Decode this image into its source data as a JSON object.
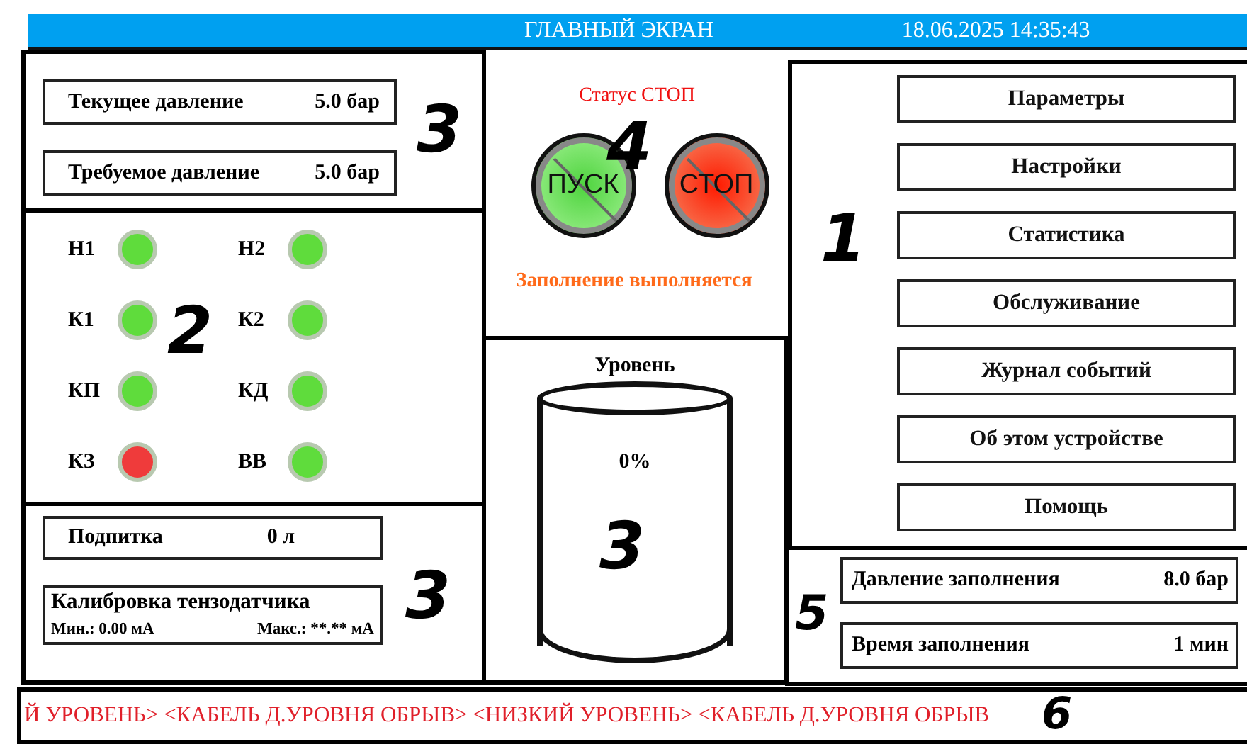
{
  "header": {
    "title": "ГЛАВНЫЙ ЭКРАН",
    "datetime": "18.06.2025 14:35:43"
  },
  "pressure_panel": {
    "callout": "3",
    "fields": [
      {
        "label": "Текущее давление",
        "value": "5.0 бар"
      },
      {
        "label": "Требуемое давление",
        "value": "5.0 бар"
      }
    ]
  },
  "lamps_panel": {
    "callout": "2",
    "lamps": [
      {
        "label": "Н1",
        "color": "#5fdc3c"
      },
      {
        "label": "Н2",
        "color": "#5fdc3c"
      },
      {
        "label": "К1",
        "color": "#5fdc3c"
      },
      {
        "label": "К2",
        "color": "#5fdc3c"
      },
      {
        "label": "КП",
        "color": "#5fdc3c"
      },
      {
        "label": "КД",
        "color": "#5fdc3c"
      },
      {
        "label": "КЗ",
        "color": "#ef3b3b"
      },
      {
        "label": "ВВ",
        "color": "#5fdc3c"
      }
    ]
  },
  "refill_panel": {
    "callout": "3",
    "refill": {
      "label": "Подпитка",
      "value": "0 л"
    },
    "calibration": {
      "title": "Калибровка тензодатчика",
      "min": "Мин.:  0.00 мА",
      "max": "Макс.: **.** мА"
    }
  },
  "status_panel": {
    "callout": "4",
    "status": "Статус СТОП",
    "buttons": [
      {
        "label": "ПУСК",
        "kind": "start"
      },
      {
        "label": "СТОП",
        "kind": "stop"
      }
    ],
    "message": "Заполнение выполняется"
  },
  "level_panel": {
    "callout": "3",
    "title": "Уровень",
    "reading": "0%"
  },
  "menu_panel": {
    "callout": "1",
    "items": [
      "Параметры",
      "Настройки",
      "Статистика",
      "Обслуживание",
      "Журнал событий",
      "Об этом устройстве",
      "Помощь"
    ]
  },
  "fill_panel": {
    "callout": "5",
    "fields": [
      {
        "label": "Давление заполнения",
        "value": "8.0 бар"
      },
      {
        "label": "Время заполнения",
        "value": "1 мин"
      }
    ]
  },
  "ticker": {
    "callout": "6",
    "text": "Й УРОВЕНЬ> <КАБЕЛЬ Д.УРОВНЯ ОБРЫВ> <НИЗКИЙ УРОВЕНЬ> <КАБЕЛЬ Д.УРОВНЯ ОБРЫВ"
  }
}
